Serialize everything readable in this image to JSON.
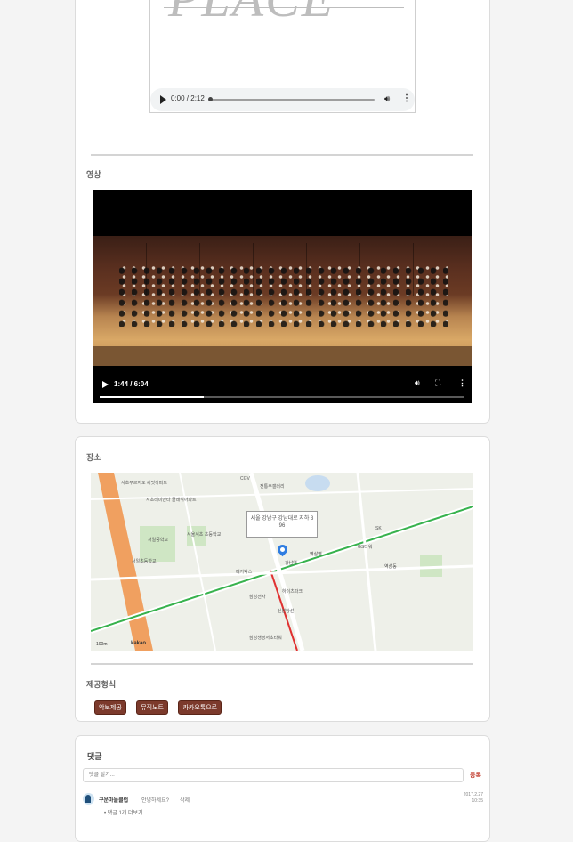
{
  "audio": {
    "logo_text": "PLACE",
    "time": "0:00 / 2:12",
    "progress": 0.0
  },
  "video_section": {
    "label": "영상",
    "time": "1:44 / 6:04",
    "progress": 0.286
  },
  "place_section": {
    "label": "장소",
    "map_popup": "서울 강남구 강남대로 지하 3 96",
    "map_brand": "kakao",
    "map_scale": "100m",
    "map_labels": [
      "서초푸르지오 써밋아파트",
      "서초래미안타 클래식아파트",
      "서일중학교",
      "서울서초 초등학교",
      "서일초등학교",
      "CGV",
      "전통주갤러리",
      "삼성전자",
      "신분당선",
      "SK",
      "강남역",
      "역삼역",
      "메가박스",
      "GS타워",
      "역삼동",
      "삼성생명서초타워",
      "하이츠파크"
    ]
  },
  "provide_section": {
    "label": "제공형식",
    "tags": [
      "악보제공",
      "뮤직노트",
      "카카오톡으로"
    ]
  },
  "comments_section": {
    "title": "댓글",
    "input_placeholder": "댓글 달기...",
    "submit_label": "등록",
    "comment": {
      "user": "구운마늘클럽",
      "text": "안녕하세요?",
      "delete_label": "삭제",
      "date_line1": "2017.2.27",
      "date_line2": "10:35",
      "replies_label": "• 댓글 1개 더보기"
    }
  }
}
